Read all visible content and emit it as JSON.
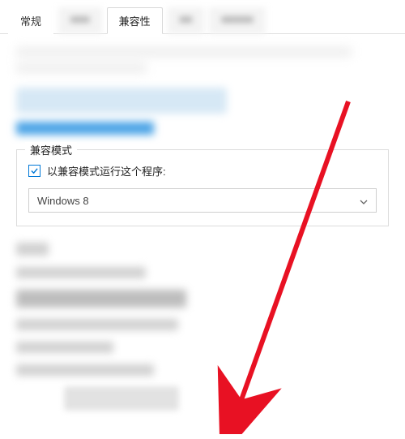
{
  "tabs": {
    "general": "常规",
    "blurred1": "■■■",
    "compat": "兼容性",
    "blurred2": "■■",
    "blurred3": "■■■■■"
  },
  "group": {
    "title": "兼容模式",
    "checkbox_label": "以兼容模式运行这个程序:",
    "checked": true,
    "select_value": "Windows 8"
  }
}
